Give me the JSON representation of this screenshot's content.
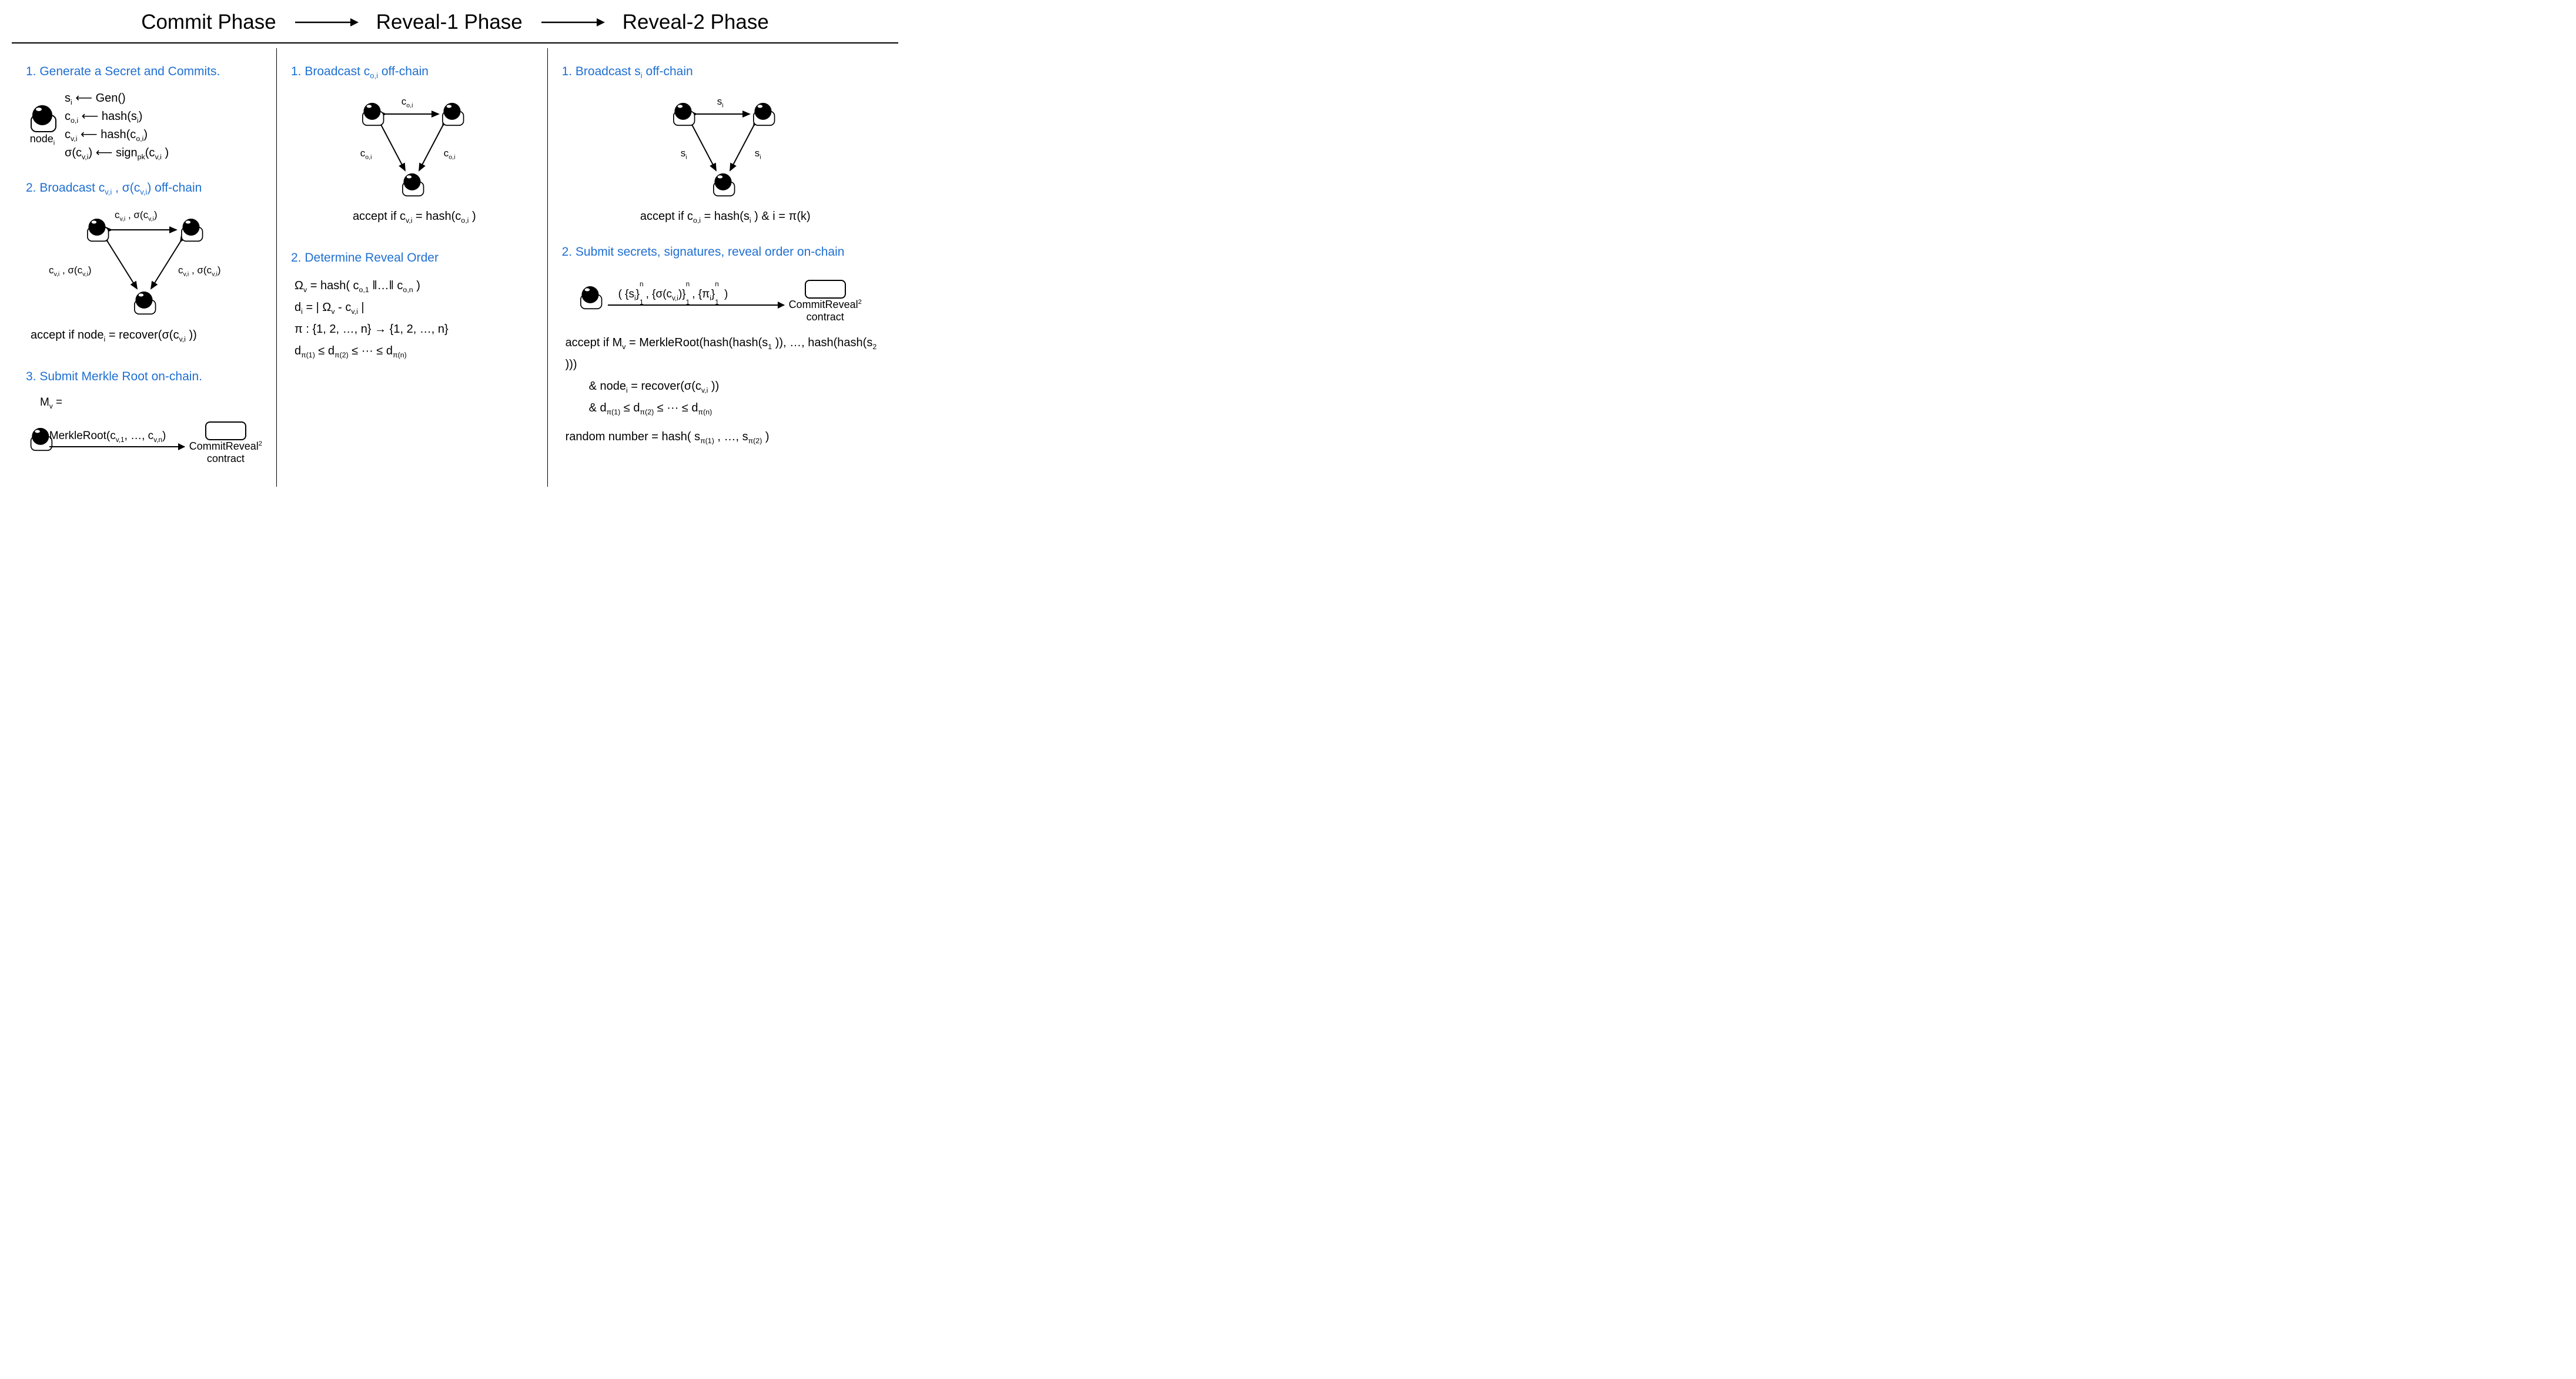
{
  "header": {
    "phase1": "Commit Phase",
    "phase2": "Reveal-1 Phase",
    "phase3": "Reveal-2 Phase"
  },
  "commit": {
    "s1_title": "1. Generate a Secret and Commits.",
    "node_label": "node",
    "node_sub": "i",
    "eq1_lhs": "s",
    "eq1_lsub": "i",
    "eq1_rhs": "Gen()",
    "eq2_lhs": "c",
    "eq2_lsub": "o,i",
    "eq2_rhs_pre": "hash(s",
    "eq2_rhs_sub": "i",
    "eq2_rhs_post": ")",
    "eq3_lhs": "c",
    "eq3_lsub": "v,i",
    "eq3_rhs_pre": "hash(c",
    "eq3_rhs_sub": "o,i",
    "eq3_rhs_post": ")",
    "eq4_lhs_pre": "σ(c",
    "eq4_lhs_sub": "v,i",
    "eq4_lhs_post": ")",
    "eq4_rhs_pre": "sign",
    "eq4_rhs_sub": "pk",
    "eq4_rhs_mid": "(c",
    "eq4_rhs_sub2": "v,i",
    "eq4_rhs_post": " )",
    "s2_title_pre": "2. Broadcast  c",
    "s2_title_sub": "v,i",
    "s2_title_mid": " , σ(c",
    "s2_title_sub2": "v,i",
    "s2_title_post": ")  off-chain",
    "tri_label_pre": "c",
    "tri_label_sub": "v,i",
    "tri_label_mid": " , σ(c",
    "tri_label_sub2": "v,i",
    "tri_label_post": ")",
    "accept2_pre": "accept if  node",
    "accept2_sub": "i",
    "accept2_mid": " = recover(σ(c",
    "accept2_sub2": "v,i",
    "accept2_post": " ))",
    "s3_title": "3. Submit Merkle Root on-chain.",
    "mr_lhs": "M",
    "mr_lsub": "v",
    "mr_eq": " =",
    "mr_rhs_pre": "MerkleRoot(c",
    "mr_rhs_sub1": "v,1",
    "mr_rhs_mid": ", …, c",
    "mr_rhs_sub2": "v,n",
    "mr_rhs_post": ")",
    "contract_name": "CommitReveal",
    "contract_sup": "2",
    "contract_line2": "contract"
  },
  "reveal1": {
    "s1_title_pre": "1. Broadcast c",
    "s1_title_sub": "o,i",
    "s1_title_post": "  off-chain",
    "tri_label_pre": "c",
    "tri_label_sub": "o,i",
    "accept1_pre": "accept if  c",
    "accept1_sub": "v,i",
    "accept1_mid": " = hash(c",
    "accept1_sub2": "o,i",
    "accept1_post": " )",
    "s2_title": "2. Determine Reveal Order",
    "eq1_pre": "Ω",
    "eq1_sub": "v",
    "eq1_mid": " = hash( c",
    "eq1_sub2": "o,1",
    "eq1_mid2": " ‖…‖ c",
    "eq1_sub3": "o,n",
    "eq1_post": " )",
    "eq2_pre": "d",
    "eq2_sub": "i",
    "eq2_mid": " = | Ω",
    "eq2_sub2": "v",
    "eq2_mid2": " - c",
    "eq2_sub3": "v,i",
    "eq2_post": " |",
    "eq3": "π : {1, 2, …, n} → {1, 2, …, n}",
    "eq4_pre": "d",
    "eq4_sub": "π(1)",
    "eq4_mid": " ≤ d",
    "eq4_sub2": "π(2)",
    "eq4_mid2": " ≤ ··· ≤ d",
    "eq4_sub3": "π(n)"
  },
  "reveal2": {
    "s1_title_pre": "1. Broadcast  s",
    "s1_title_sub": "i",
    "s1_title_post": "  off-chain",
    "tri_label_pre": "s",
    "tri_label_sub": "i",
    "accept1_pre": "accept if  c",
    "accept1_sub": "o,i",
    "accept1_mid": " = hash(s",
    "accept1_sub2": "i",
    "accept1_post": " )   &   i = π(k)",
    "s2_title": "2. Submit secrets, signatures, reveal order on-chain",
    "payload_pre": "( {s",
    "payload_sub1": "i",
    "payload_sup1": "n",
    "payload_low1": "1",
    "payload_mid1": ", {σ(c",
    "payload_sub2": "v,i",
    "payload_mid1b": ")}",
    "payload_sup2": "n",
    "payload_low2": "1",
    "payload_mid2": ", {π",
    "payload_sub3": "i",
    "payload_mid2b": "}",
    "payload_sup3": "n",
    "payload_low3": "1",
    "payload_post": " )",
    "contract_name": "CommitReveal",
    "contract_sup": "2",
    "contract_line2": "contract",
    "ok1_pre": "accept if  M",
    "ok1_sub": "v",
    "ok1_mid": " = MerkleRoot(hash(hash(s",
    "ok1_sub2": "1",
    "ok1_mid2": " )), …, hash(hash(s",
    "ok1_sub3": "2",
    "ok1_post": " )))",
    "ok2_pre": "&  node",
    "ok2_sub": "i",
    "ok2_mid": " = recover(σ(c",
    "ok2_sub2": "v,i",
    "ok2_post": " ))",
    "ok3_pre": "&  d",
    "ok3_sub": "π(1)",
    "ok3_mid": " ≤ d",
    "ok3_sub2": "π(2)",
    "ok3_mid2": " ≤ ··· ≤ d",
    "ok3_sub3": "π(n)",
    "rnd_pre": "random number = hash( s",
    "rnd_sub": "π(1)",
    "rnd_mid": " , …, s",
    "rnd_sub2": "π(2)",
    "rnd_post": " )"
  }
}
